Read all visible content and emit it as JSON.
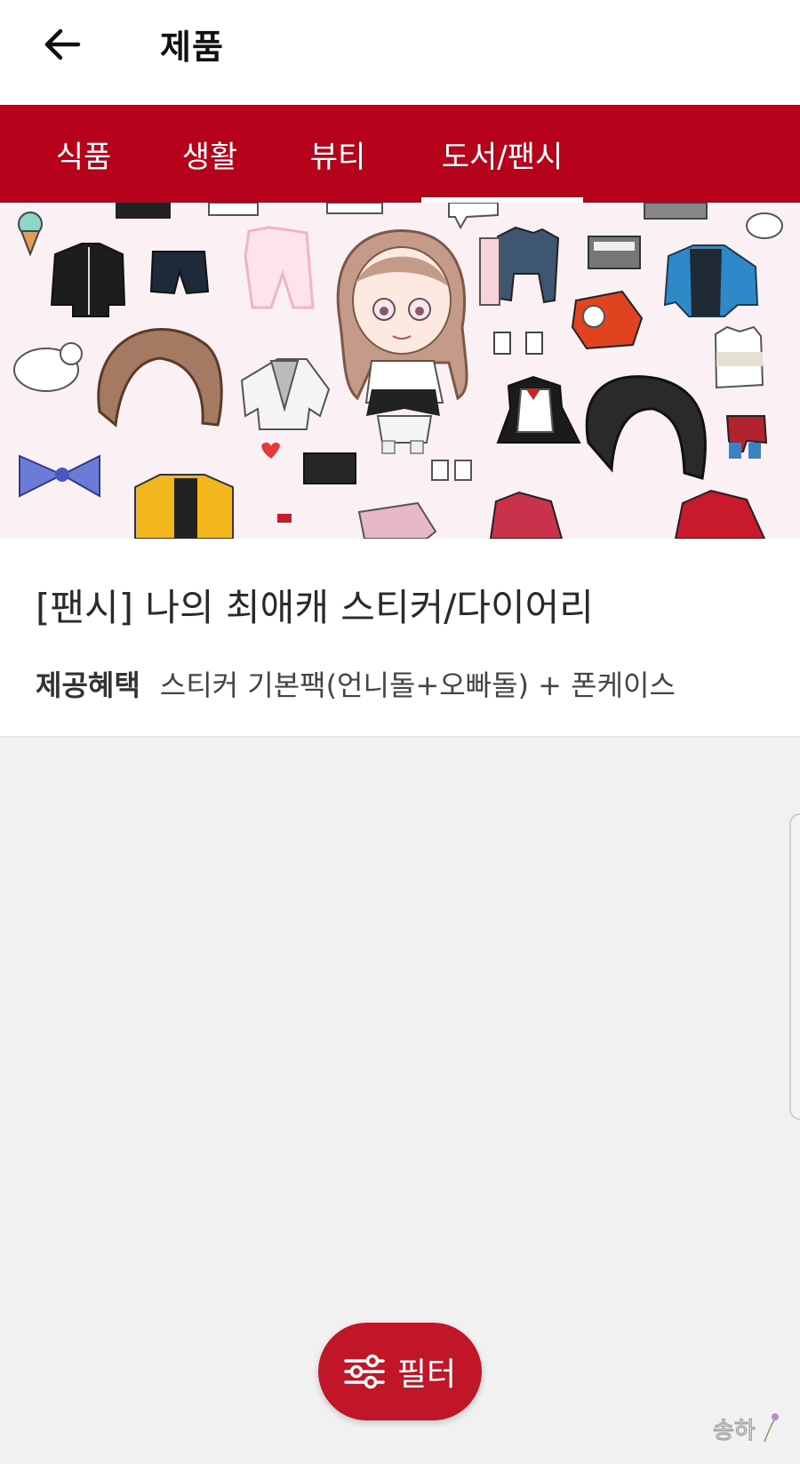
{
  "header": {
    "title": "제품",
    "back_icon": "arrow-left-icon"
  },
  "tabs": [
    {
      "label": "식품",
      "active": false
    },
    {
      "label": "생활",
      "active": false
    },
    {
      "label": "뷰티",
      "active": false
    },
    {
      "label": "도서/팬시",
      "active": true
    }
  ],
  "product": {
    "title": "[팬시] 나의 최애캐 스티커/다이어리",
    "benefit_label": "제공혜택",
    "benefit_text": "스티커 기본팩(언니돌+오빠돌) + 폰케이스"
  },
  "filter_button": {
    "label": "필터",
    "icon": "sliders-icon"
  },
  "watermark": {
    "text": "송하"
  },
  "colors": {
    "accent": "#b6021a",
    "filter": "#c01627",
    "background": "#f2f1f2"
  }
}
